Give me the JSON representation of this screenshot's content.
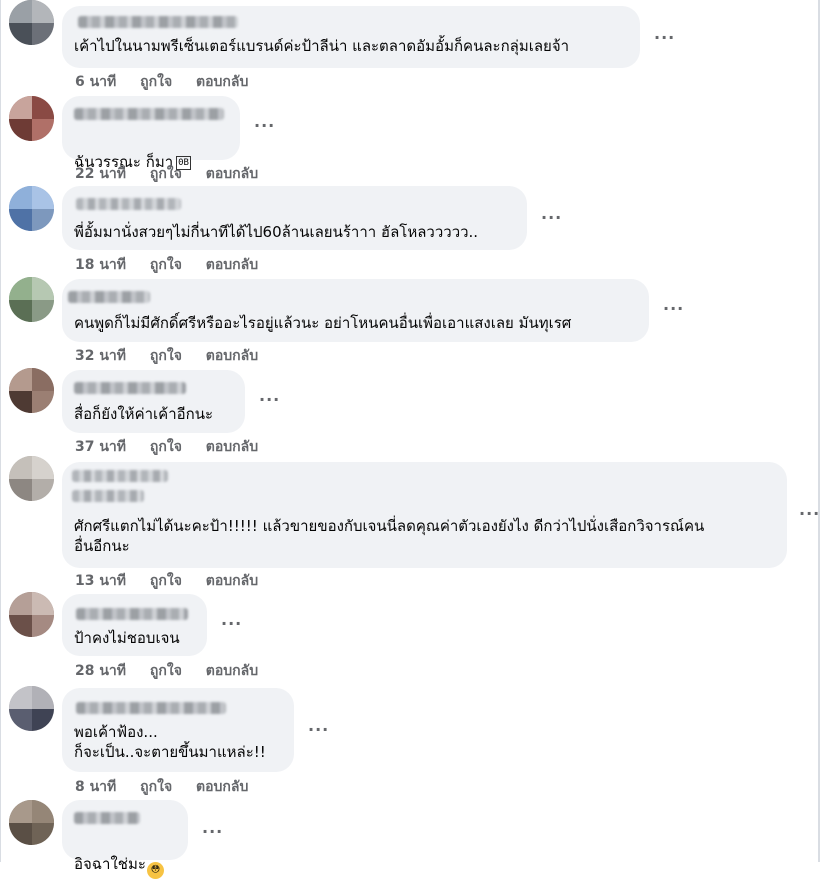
{
  "actions": {
    "like": "ถูกใจ",
    "reply": "ตอบกลับ",
    "more": "···"
  },
  "comments": [
    {
      "text": "เค้าไปในนามพรีเซ็นเตอร์แบรนด์ค่ะป้าลีน่า และตลาดอัมอั้มก็คนละกลุ่มเลยจ้า",
      "time": "6 นาที"
    },
    {
      "text": "ฉันวรรณะ ก็มา",
      "emoji": "😂",
      "time": "22 นาที"
    },
    {
      "text": "พี่อั้มมานั่งสวยๆไม่กี่นาทีได้ไป60ล้านเลยนร้าาา ฮัลโหลววววว..",
      "time": "18 นาที"
    },
    {
      "text": "คนพูดก็ไม่มีศักดิ์ศรีหรืออะไรอยู่แล้วนะ อย่าโหนคนอื่นเพื่อเอาแสงเลย มันทุเรศ",
      "time": "32 นาที"
    },
    {
      "text": "สื่อก็ยังให้ค่าเค้าอีกนะ",
      "time": "37 นาที"
    },
    {
      "text": "ศักศรีแตกไม่ได้นะคะป้า!!!!! แล้วขายของกับเจนนี่ลดคุณค่าตัวเองยังไง ดีกว่าไปนั่งเสือกวิจารณ์คน\nอื่นอีกนะ",
      "time": "13 นาที"
    },
    {
      "text": "ป้าคงไม่ชอบเจน",
      "time": "28 นาที"
    },
    {
      "text": "พอเค้าฟ้อง...\nก็จะเป็น..จะตายขึ้นมาแหล่ะ!!",
      "time": "8 นาที"
    },
    {
      "text": "อิจฉาใช่มะ",
      "emoji": "😳",
      "time": ""
    }
  ],
  "colors": {
    "bubble": "#f0f2f5",
    "meta": "#65676b",
    "text": "#050505"
  }
}
